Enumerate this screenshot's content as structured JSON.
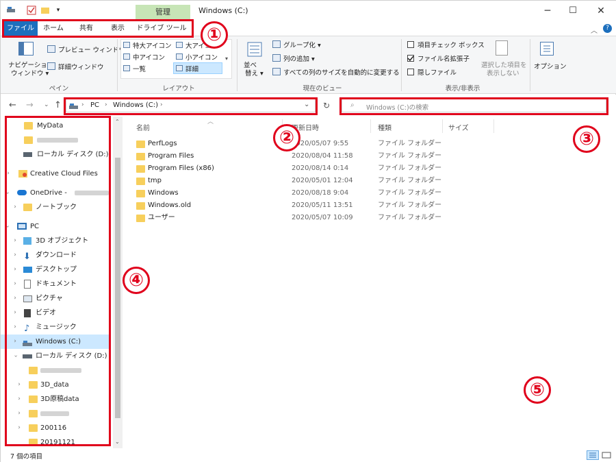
{
  "titlebar": {
    "context_tab": "管理",
    "window_title": "Windows (C:)",
    "min_glyph": "─",
    "max_glyph": "☐",
    "close_glyph": "✕"
  },
  "tabs": [
    "ファイル",
    "ホーム",
    "共有",
    "表示",
    "ドライブ ツール"
  ],
  "ribbon": {
    "pane_group": {
      "nav_pane_label_1": "ナビゲーション",
      "nav_pane_label_2": "ウィンドウ ▾",
      "preview_pane": "プレビュー ウィンドウ",
      "details_pane": "詳細ウィンドウ",
      "label": "ペイン"
    },
    "layout_group": {
      "items": [
        "特大アイコン",
        "大アイコン",
        "中アイコン",
        "小アイコン",
        "一覧",
        "詳細"
      ],
      "label": "レイアウト"
    },
    "view_group": {
      "sort_label_1": "並べ",
      "sort_label_2": "替え ▾",
      "group_by": "グループ化 ▾",
      "add_column": "列の追加 ▾",
      "fit_columns": "すべての列のサイズを自動的に変更する",
      "label": "現在のビュー"
    },
    "showhide_group": {
      "item_checkbox": "項目チェック ボックス",
      "file_ext": "ファイル名拡張子",
      "hidden_files": "隠しファイル",
      "hide_selected_1": "選択した項目を",
      "hide_selected_2": "表示しない",
      "label": "表示/非表示"
    },
    "options": "オプション"
  },
  "address": {
    "crumbs": [
      "PC",
      "Windows (C:)"
    ],
    "search_placeholder": "Windows (C:)の検索"
  },
  "nav": {
    "items": [
      {
        "label": "MyData"
      },
      {
        "label": "ローカル ディスク (D:)"
      },
      {
        "label": "Creative Cloud Files"
      },
      {
        "label": "OneDrive -"
      },
      {
        "label": "ノートブック"
      },
      {
        "label": "PC"
      },
      {
        "label": "3D オブジェクト"
      },
      {
        "label": "ダウンロード"
      },
      {
        "label": "デスクトップ"
      },
      {
        "label": "ドキュメント"
      },
      {
        "label": "ピクチャ"
      },
      {
        "label": "ビデオ"
      },
      {
        "label": "ミュージック"
      },
      {
        "label": "Windows (C:)"
      },
      {
        "label": "ローカル ディスク (D:)"
      },
      {
        "label": "3D_data"
      },
      {
        "label": "3D原稿data"
      },
      {
        "label": "200116"
      },
      {
        "label": "20191121"
      }
    ]
  },
  "columns": {
    "name": "名前",
    "date": "更新日時",
    "type": "種類",
    "size": "サイズ"
  },
  "files": [
    {
      "name": "PerfLogs",
      "date": "2020/05/07 9:55",
      "type": "ファイル フォルダー"
    },
    {
      "name": "Program Files",
      "date": "2020/08/04 11:58",
      "type": "ファイル フォルダー"
    },
    {
      "name": "Program Files (x86)",
      "date": "2020/08/14 0:14",
      "type": "ファイル フォルダー"
    },
    {
      "name": "tmp",
      "date": "2020/05/01 12:04",
      "type": "ファイル フォルダー"
    },
    {
      "name": "Windows",
      "date": "2020/08/18 9:04",
      "type": "ファイル フォルダー"
    },
    {
      "name": "Windows.old",
      "date": "2020/05/11 13:51",
      "type": "ファイル フォルダー"
    },
    {
      "name": "ユーザー",
      "date": "2020/05/07 10:09",
      "type": "ファイル フォルダー"
    }
  ],
  "status": {
    "item_count": "7 個の項目"
  },
  "annotations": [
    "①",
    "②",
    "③",
    "④",
    "⑤"
  ],
  "colors": {
    "accent": "#1d6fbd",
    "annotation_red": "#e0001b",
    "context_tab": "#c7e5b6",
    "folder": "#f7cf5c",
    "selected": "#cce8ff"
  }
}
